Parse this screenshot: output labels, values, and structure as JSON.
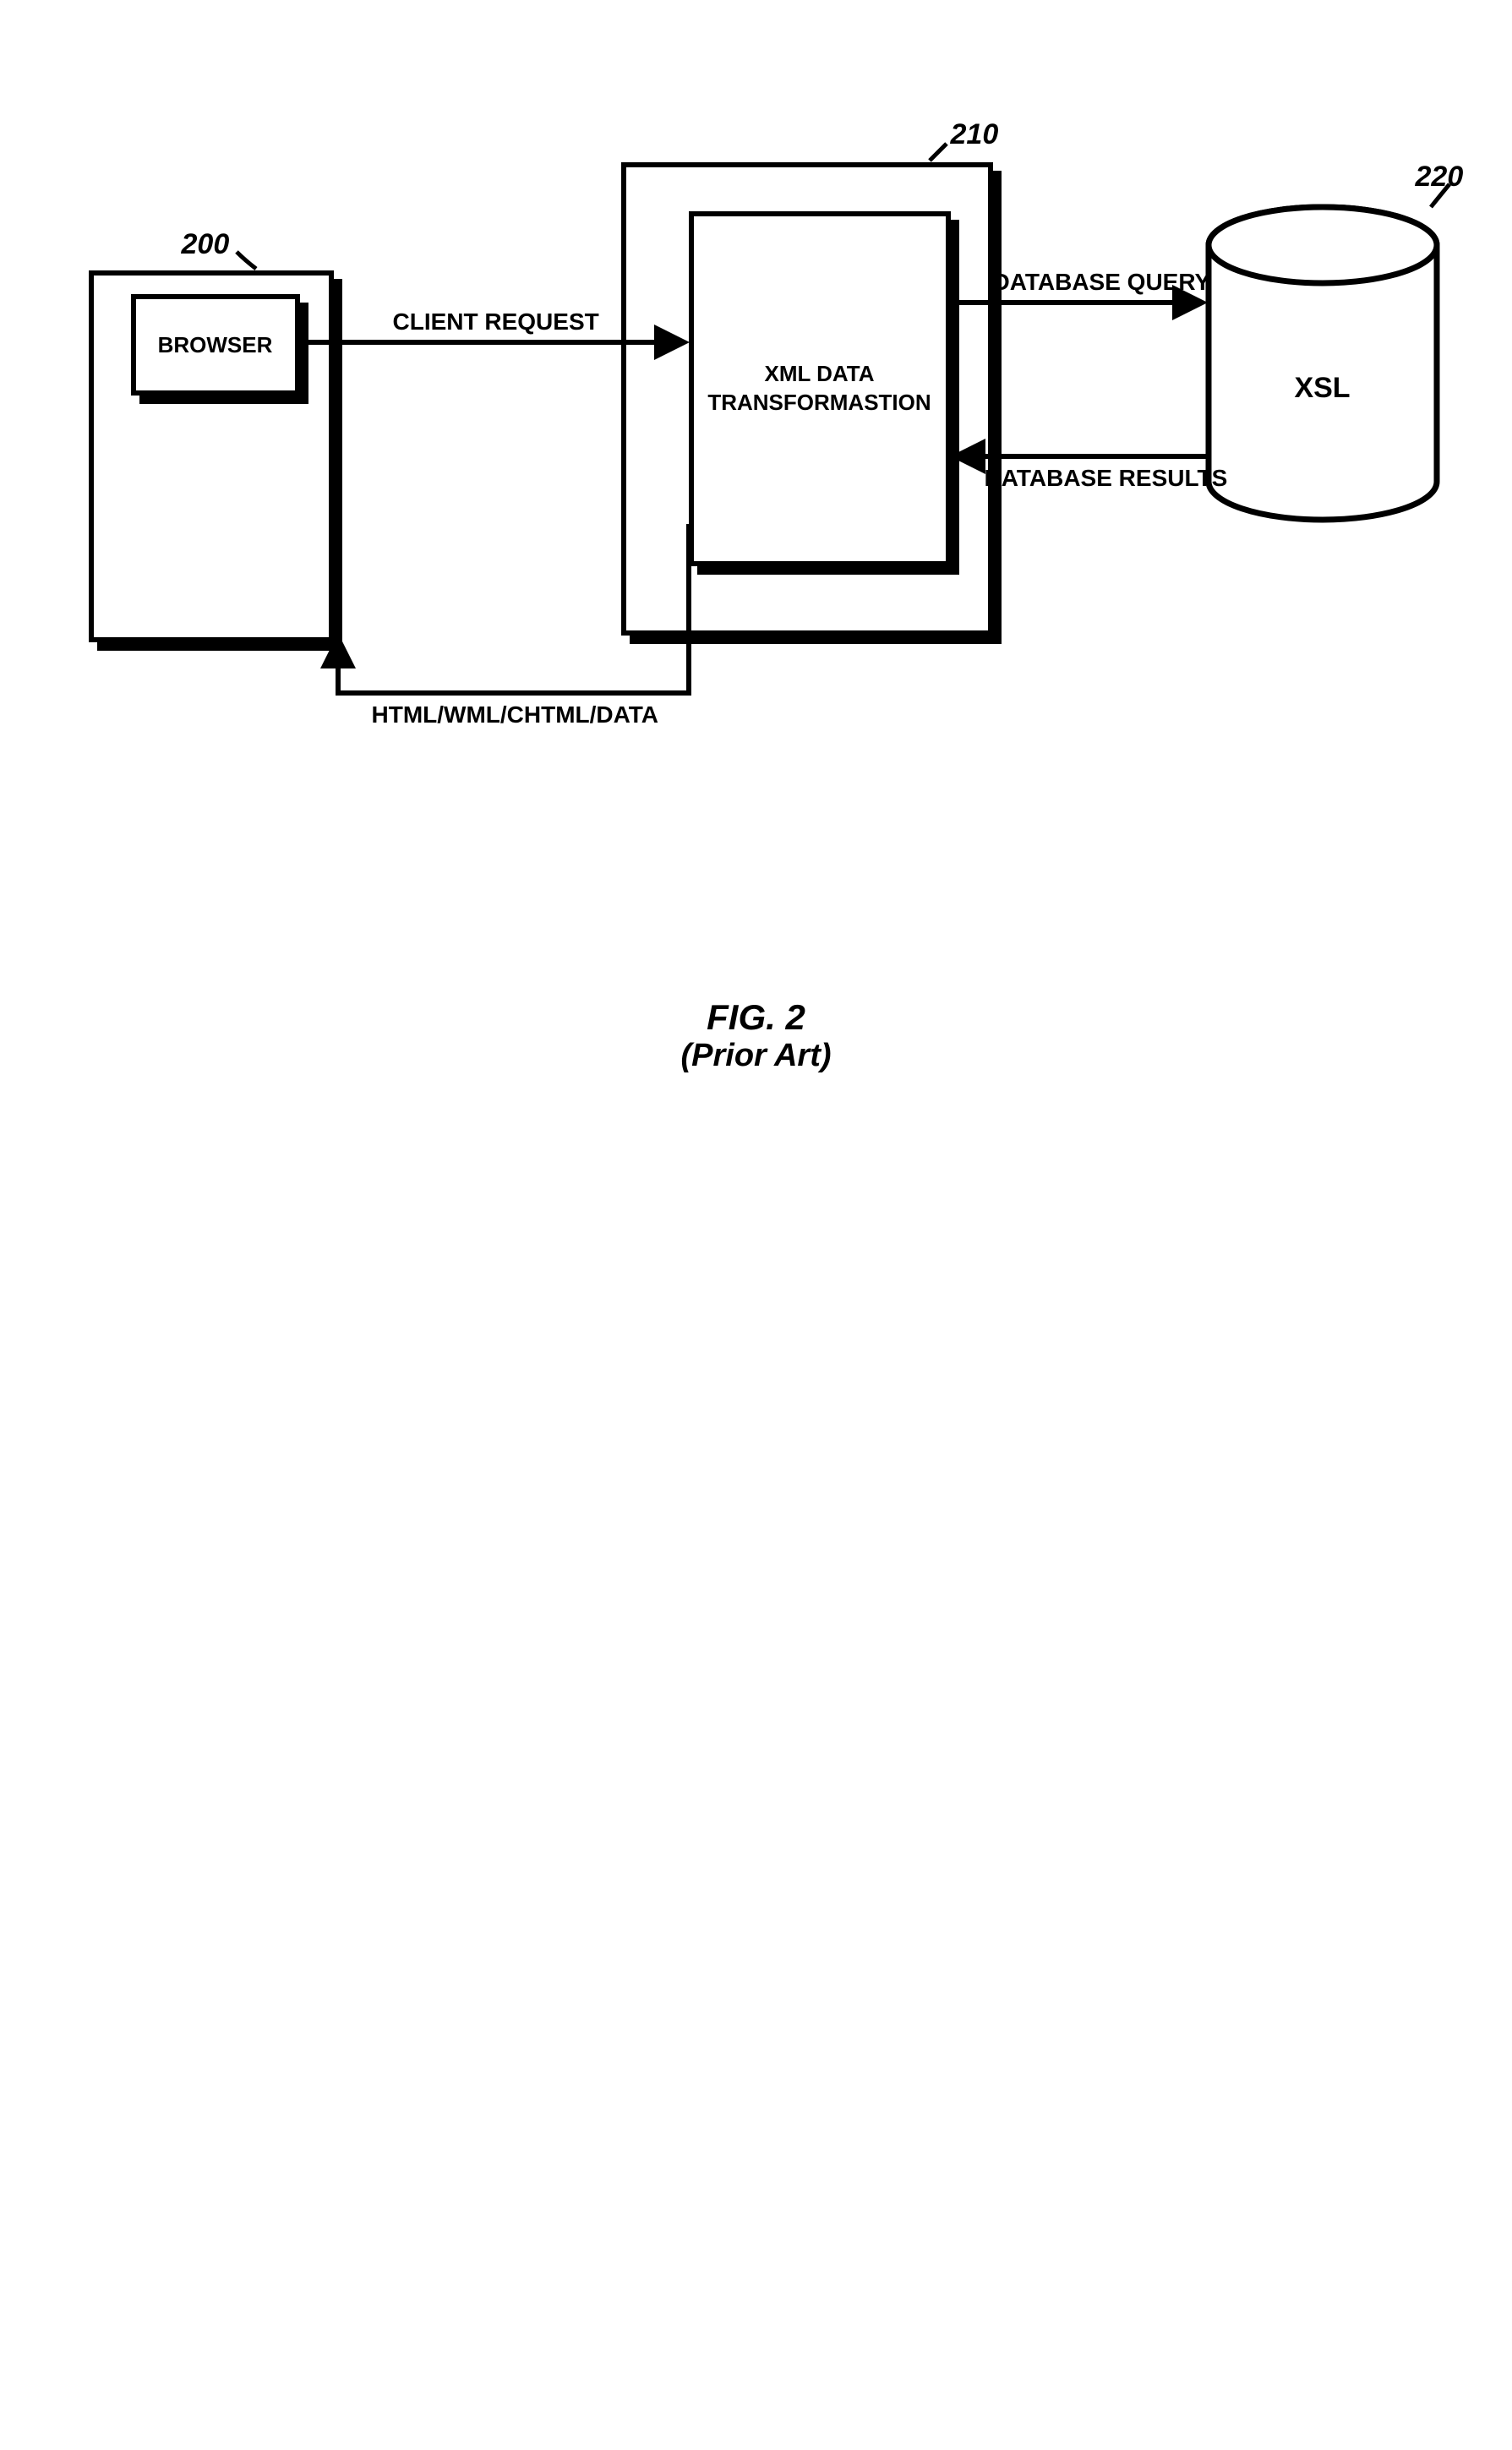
{
  "nodes": {
    "browser": {
      "label": "BROWSER",
      "ref": "200"
    },
    "server": {
      "label": "XML DATA\nTRANSFORMASTION",
      "ref": "210"
    },
    "db": {
      "label": "XSL",
      "ref": "220"
    }
  },
  "edges": {
    "clientRequest": "CLIENT REQUEST",
    "htmlResponse": "HTML/WML/CHTML/DATA",
    "dbQuery": "DATABASE QUERY",
    "dbResults": "DATABASE RESULTS"
  },
  "figure": {
    "title": "FIG. 2",
    "subtitle": "(Prior Art)"
  }
}
